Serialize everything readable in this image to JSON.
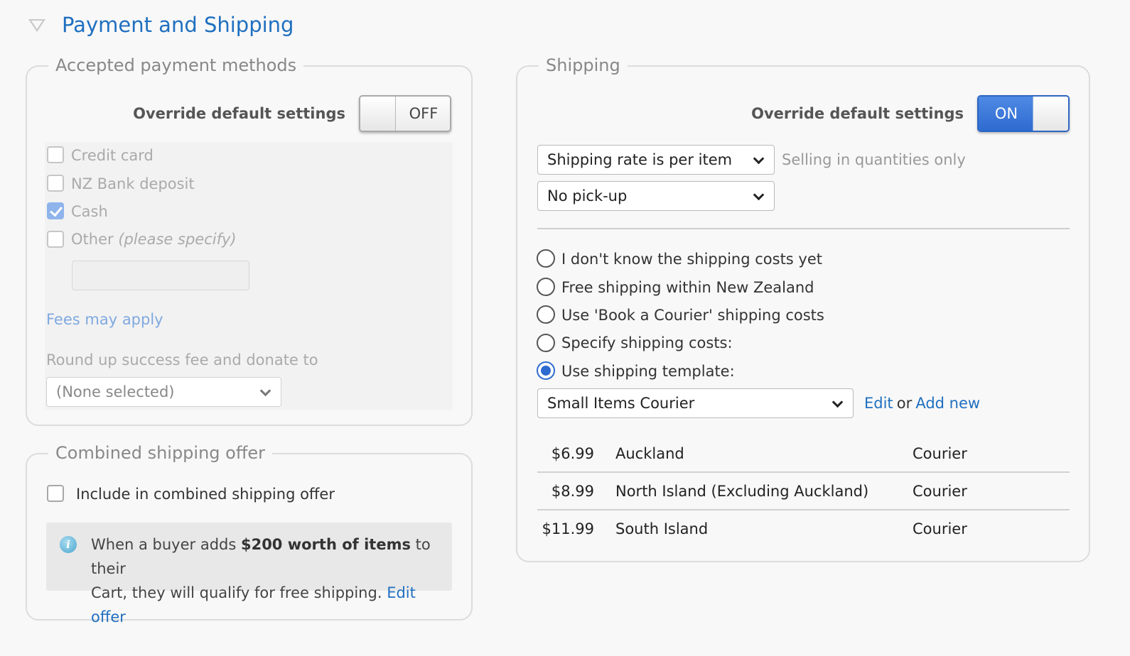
{
  "header": {
    "title": "Payment and Shipping",
    "collapse_icon": "triangle-down-icon"
  },
  "payment": {
    "legend": "Accepted payment methods",
    "override_label": "Override default settings",
    "override_toggle": {
      "state_label": "OFF",
      "on": false
    },
    "methods": [
      {
        "label": "Credit card",
        "checked": false
      },
      {
        "label": "NZ Bank deposit",
        "checked": false
      },
      {
        "label": "Cash",
        "checked": true
      },
      {
        "label": "Other",
        "suffix": "(please specify)",
        "checked": false
      }
    ],
    "other_value": "",
    "fees_link": "Fees may apply",
    "donate_label": "Round up success fee and donate to",
    "donate_select": "(None selected)"
  },
  "combined": {
    "legend": "Combined shipping offer",
    "include_label": "Include in combined shipping offer",
    "include_checked": false,
    "info": {
      "text_before": "When a buyer adds ",
      "text_bold": "$200 worth of items",
      "text_after_line1": " to their",
      "text_line2": "Cart, they will qualify for free shipping. ",
      "edit_link": "Edit offer"
    }
  },
  "shipping": {
    "legend": "Shipping",
    "override_label": "Override default settings",
    "override_toggle": {
      "state_label": "ON",
      "on": true
    },
    "rate_select": "Shipping rate is per item",
    "rate_note": "Selling in quantities only",
    "pickup_select": "No pick-up",
    "options": [
      {
        "label": "I don't know the shipping costs yet",
        "selected": false
      },
      {
        "label": "Free shipping within New Zealand",
        "selected": false
      },
      {
        "label": "Use 'Book a Courier' shipping costs",
        "selected": false
      },
      {
        "label": "Specify shipping costs:",
        "selected": false
      },
      {
        "label": "Use shipping template:",
        "selected": true
      }
    ],
    "template_select": "Small Items Courier",
    "edit_link": "Edit",
    "or_text": "or",
    "add_new_link": "Add new",
    "rates": [
      {
        "price": "$6.99",
        "region": "Auckland",
        "method": "Courier"
      },
      {
        "price": "$8.99",
        "region": "North Island (Excluding Auckland)",
        "method": "Courier"
      },
      {
        "price": "$11.99",
        "region": "South Island",
        "method": "Courier"
      }
    ]
  }
}
